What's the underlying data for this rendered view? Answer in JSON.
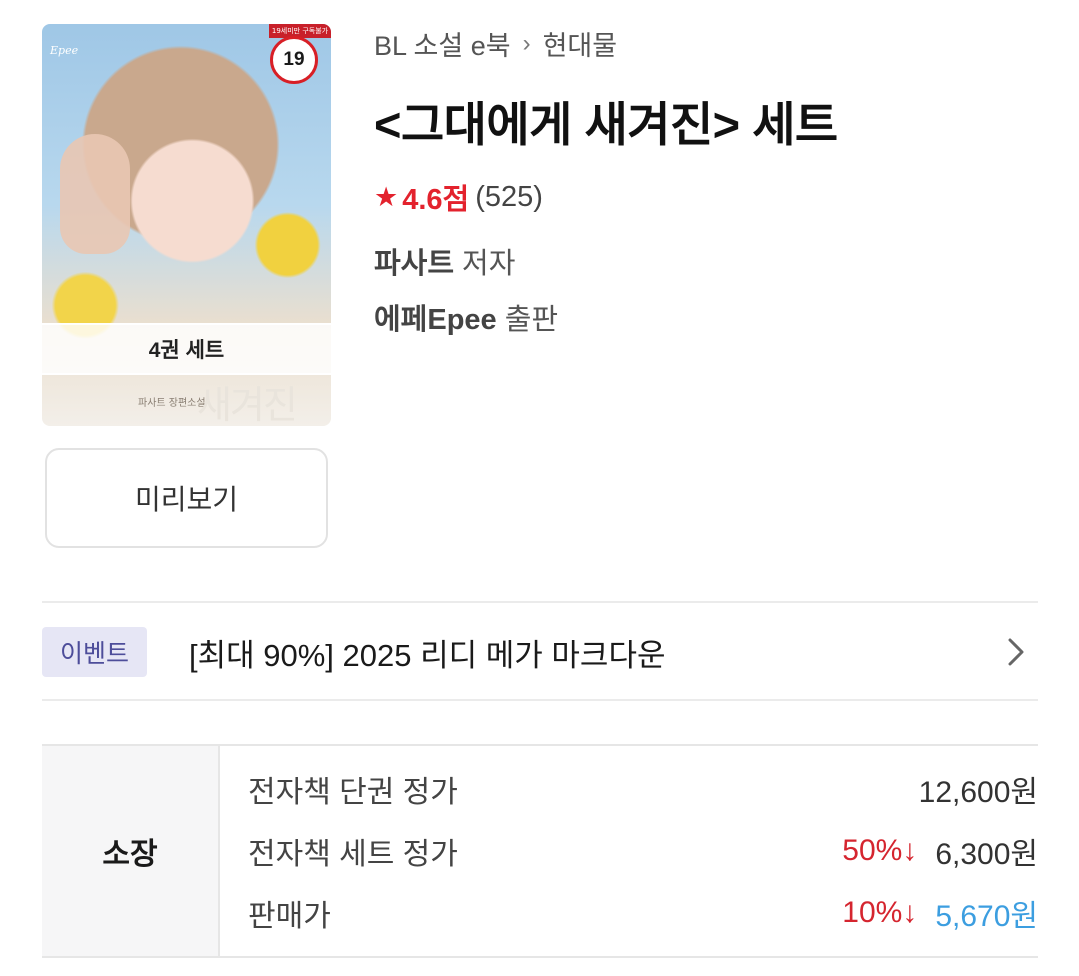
{
  "cover": {
    "age_rating": "19",
    "age_strip_text": "19세미만 구독불가",
    "publisher_logo": "Epee",
    "set_count": "4권 세트",
    "art_title": "새겨진",
    "art_author": "파사트 장편소설"
  },
  "preview_button": "미리보기",
  "breadcrumb": {
    "category": "BL 소설 e북",
    "separator": "›",
    "subcategory": "현대물"
  },
  "title": "<그대에게 새겨진> 세트",
  "rating": {
    "icon": "star-icon",
    "score": "4.6점",
    "count": "(525)"
  },
  "author": {
    "name": "파사트",
    "role": "저자"
  },
  "publisher": {
    "name": "에페Epee",
    "role": "출판"
  },
  "event": {
    "badge": "이벤트",
    "text": "[최대 90%] 2025 리디 메가 마크다운"
  },
  "pricing": {
    "section_label": "소장",
    "rows": [
      {
        "label": "전자책 단권 정가",
        "discount": "",
        "amount": "12,600원"
      },
      {
        "label": "전자책 세트 정가",
        "discount": "50%↓",
        "amount": "6,300원"
      },
      {
        "label": "판매가",
        "discount": "10%↓",
        "amount": "5,670원"
      }
    ]
  },
  "colors": {
    "accent_red": "#e3222d",
    "sale_blue": "#3c9ee0",
    "event_badge_bg": "#e6e6f5",
    "event_badge_text": "#4d4d9a"
  }
}
